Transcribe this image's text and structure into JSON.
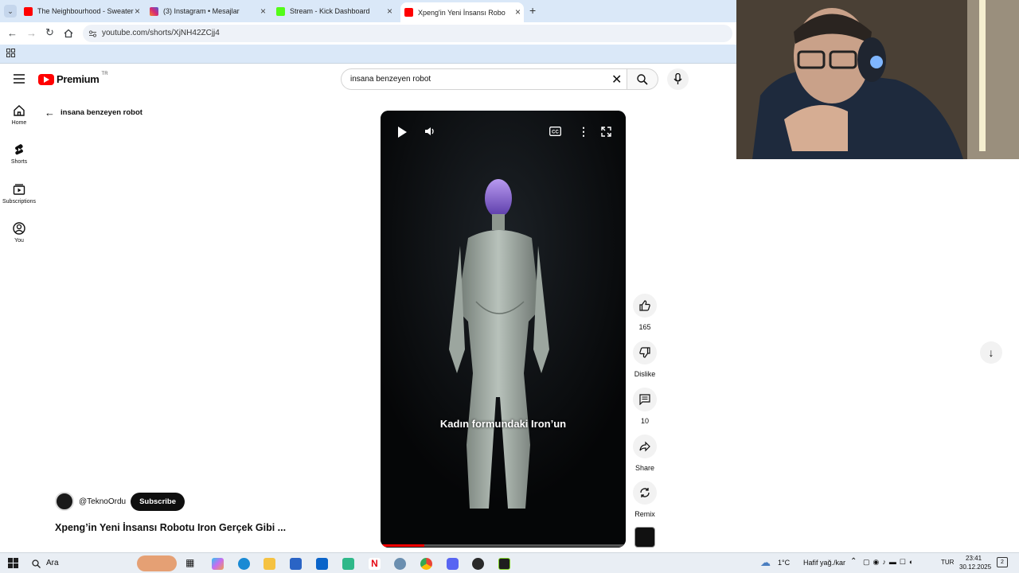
{
  "browser": {
    "tabs": [
      {
        "title": "The Neighbourhood - Sweater",
        "favicon_color": "#ff0000"
      },
      {
        "title": "(3) Instagram • Mesajlar",
        "favicon_color": "#d62976"
      },
      {
        "title": "Stream - Kick Dashboard",
        "favicon_color": "#53fc18"
      },
      {
        "title": "Xpeng'in Yeni İnsansı Robotu Ir",
        "favicon_color": "#ff0000"
      }
    ],
    "url": "youtube.com/shorts/XjNH42ZCjj4"
  },
  "youtube": {
    "logo_text": "Premium",
    "region": "TR",
    "search_value": "insana benzeyen robot",
    "sidebar": [
      {
        "label": "Home",
        "icon": "home-icon"
      },
      {
        "label": "Shorts",
        "icon": "shorts-icon"
      },
      {
        "label": "Subscriptions",
        "icon": "subscriptions-icon"
      },
      {
        "label": "You",
        "icon": "you-icon"
      }
    ],
    "back_label": "insana benzeyen robot",
    "channel": "@TeknoOrdu",
    "subscribe_label": "Subscribe",
    "video_title": "Xpeng’in Yeni İnsansı Robotu Iron Gerçek Gibi ...",
    "caption": "Kadın formundaki Iron’un",
    "progress": 0.18,
    "actions": {
      "like": "165",
      "dislike": "Dislike",
      "comments": "10",
      "share": "Share",
      "remix": "Remix"
    }
  },
  "taskbar": {
    "search_label": "Ara",
    "weather": "1°C",
    "weather_desc": "Hafif yağ./kar",
    "lang": "TUR",
    "time": "23:41",
    "date": "30.12.2025",
    "notif_count": "2"
  }
}
